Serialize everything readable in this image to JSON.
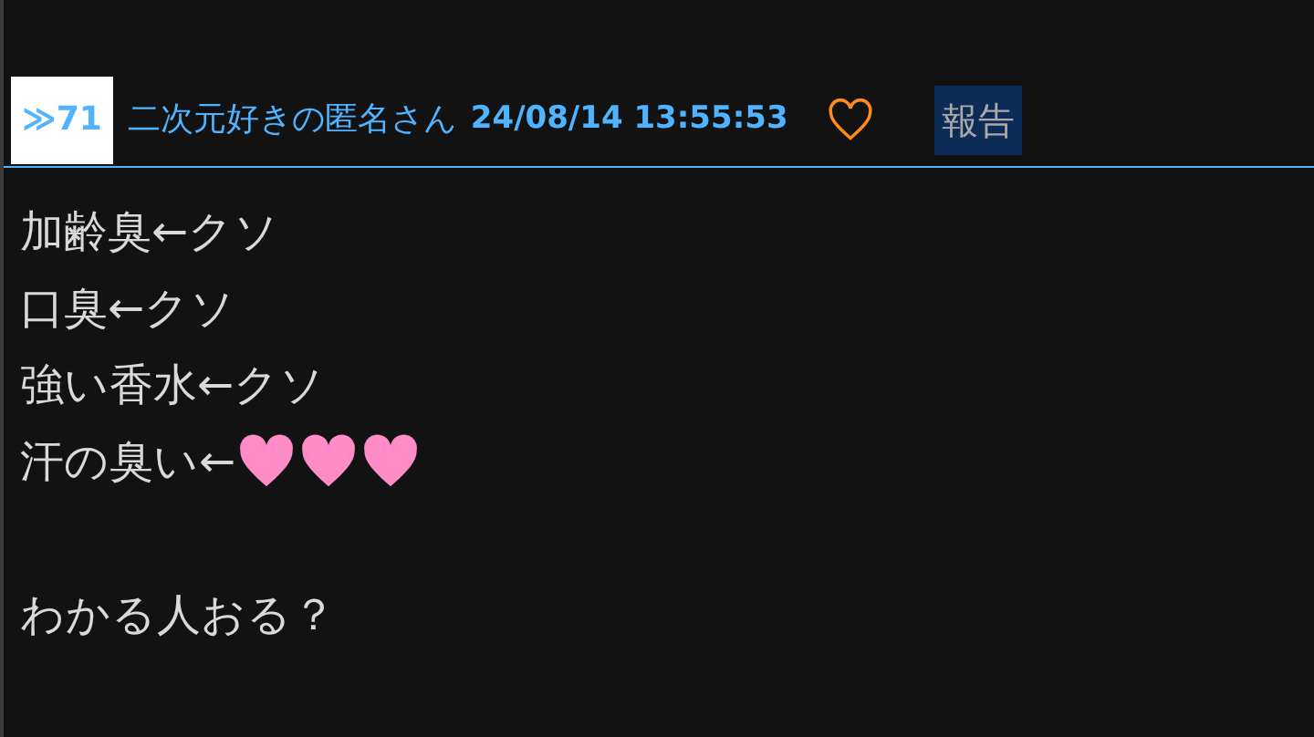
{
  "post": {
    "number": "≫71",
    "author": "二次元好きの匿名さん",
    "timestamp": "24/08/14 13:55:53",
    "liked": false,
    "report_label": "報告"
  },
  "body": [
    {
      "kind": "text",
      "text": "加齢臭←クソ"
    },
    {
      "kind": "text",
      "text": "口臭←クソ"
    },
    {
      "kind": "text",
      "text": "強い香水←クソ"
    },
    {
      "kind": "text",
      "text": "汗の臭い←",
      "hearts": [
        {
          "color": "#ff8cc6"
        },
        {
          "color": "#ff8cc6"
        },
        {
          "color": "#ff8cc6"
        }
      ]
    },
    {
      "kind": "blank"
    },
    {
      "kind": "text",
      "text": "わかる人おる？"
    }
  ]
}
